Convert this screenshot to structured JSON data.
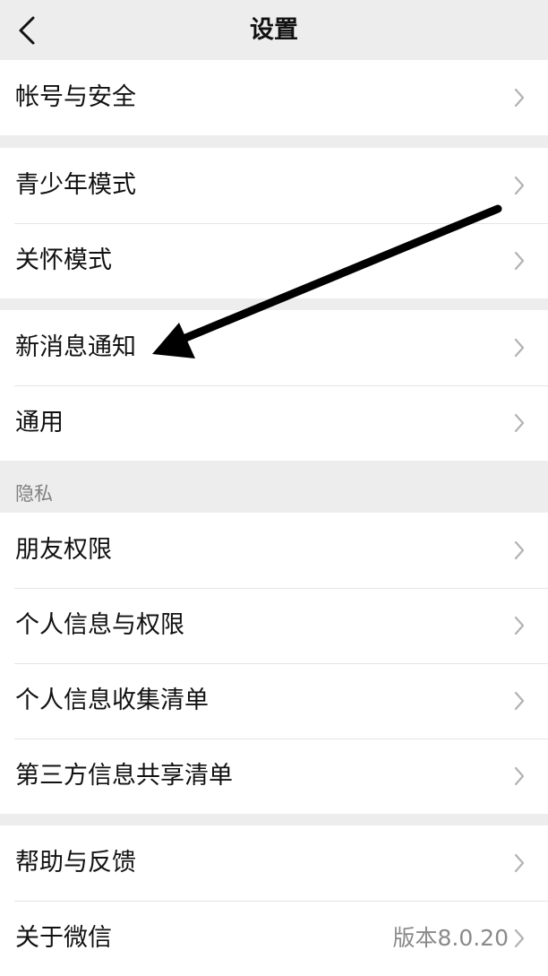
{
  "header": {
    "title": "设置"
  },
  "groups": [
    {
      "items": [
        {
          "label": "帐号与安全"
        }
      ]
    },
    {
      "items": [
        {
          "label": "青少年模式"
        },
        {
          "label": "关怀模式"
        }
      ]
    },
    {
      "items": [
        {
          "label": "新消息通知"
        },
        {
          "label": "通用"
        }
      ]
    },
    {
      "section_title": "隐私",
      "items": [
        {
          "label": "朋友权限"
        },
        {
          "label": "个人信息与权限"
        },
        {
          "label": "个人信息收集清单"
        },
        {
          "label": "第三方信息共享清单"
        }
      ]
    },
    {
      "items": [
        {
          "label": "帮助与反馈"
        },
        {
          "label": "关于微信",
          "value": "版本8.0.20"
        }
      ]
    }
  ],
  "colors": {
    "background": "#ededed",
    "cell": "#ffffff",
    "text": "#111111",
    "secondary_text": "#808080",
    "chevron": "#b2b2b2",
    "annotation": "#000000"
  },
  "icons": {
    "back": "chevron-left-icon",
    "row_indicator": "chevron-right-icon",
    "annotation": "arrow-annotation-icon"
  }
}
